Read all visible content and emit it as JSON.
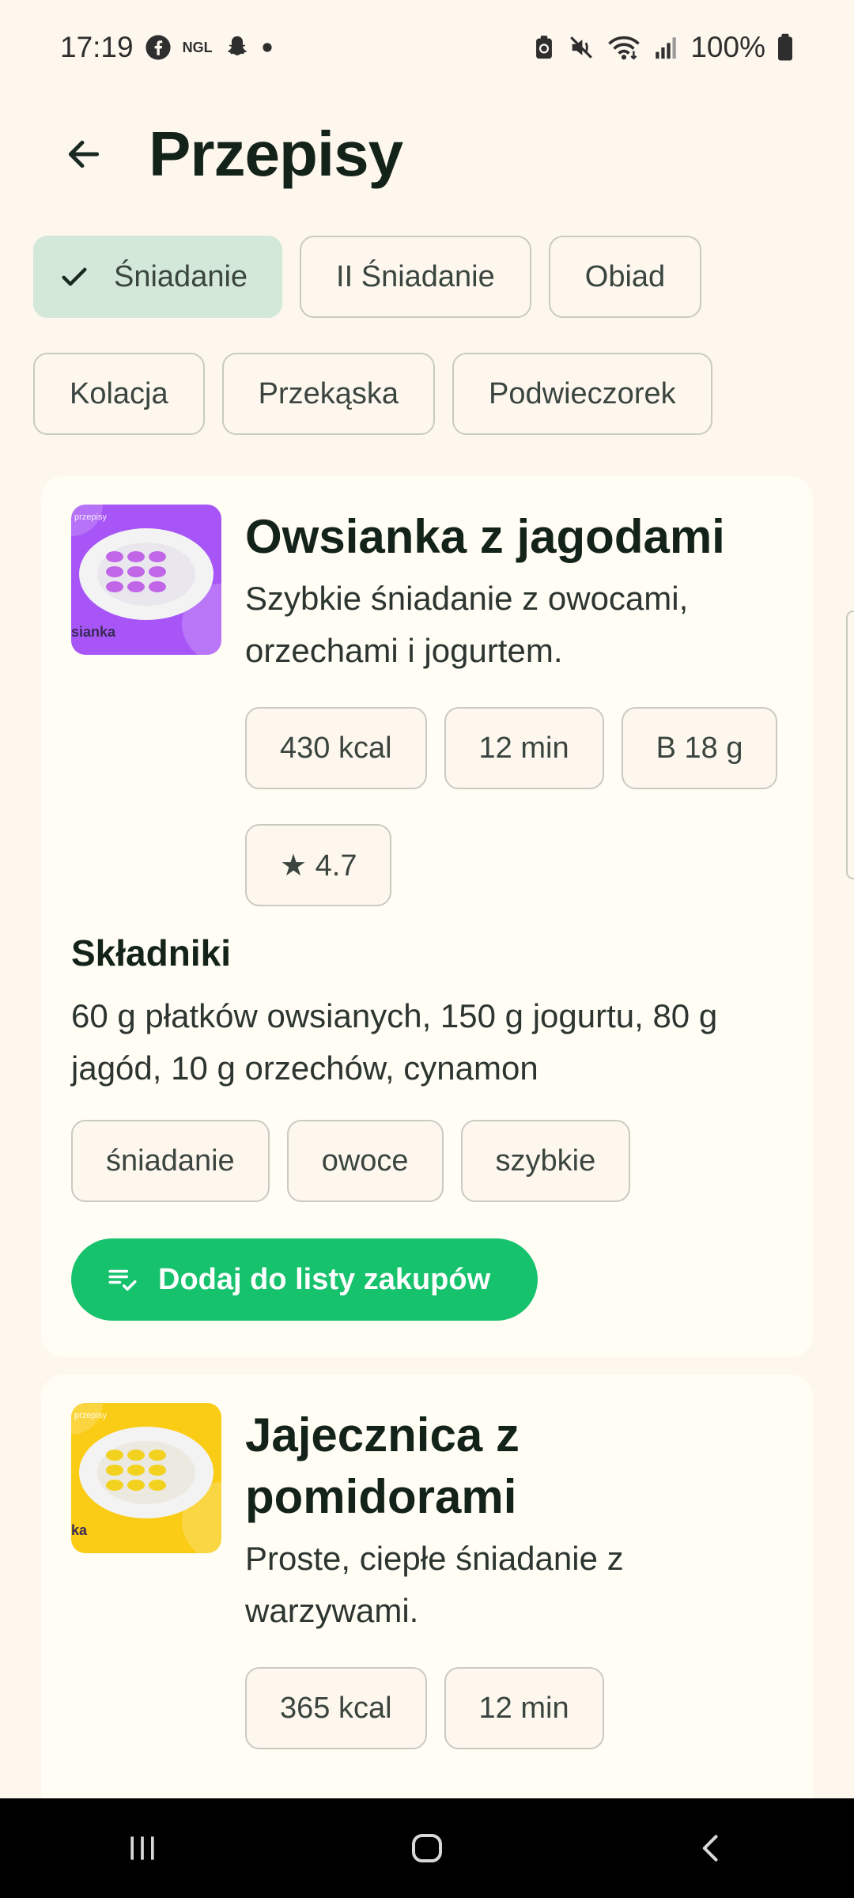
{
  "status_bar": {
    "time": "17:19",
    "notif_icons": [
      "facebook-icon",
      "ngl-icon",
      "snapchat-icon",
      "dot-icon"
    ],
    "ngl_text": "NGL",
    "system_icons": [
      "battery-saver-icon",
      "mute-icon",
      "wifi-icon",
      "signal-icon"
    ],
    "battery": "100%"
  },
  "header": {
    "title": "Przepisy",
    "back_icon": "arrow-left-icon"
  },
  "filters": [
    {
      "label": "Śniadanie",
      "selected": true
    },
    {
      "label": "II Śniadanie",
      "selected": false
    },
    {
      "label": "Obiad",
      "selected": false
    },
    {
      "label": "Kolacja",
      "selected": false
    },
    {
      "label": "Przekąska",
      "selected": false
    },
    {
      "label": "Podwieczorek",
      "selected": false
    }
  ],
  "recipes": [
    {
      "thumb_color": "#a855f7",
      "thumb_top_text": "przepisy",
      "thumb_bottom_text": "sianka",
      "title": "Owsianka z jagodami",
      "description": "Szybkie śniadanie z owocami, orzechami i jogurtem.",
      "kcal": "430 kcal",
      "time": "12 min",
      "protein": "B 18 g",
      "rating": "★ 4.7",
      "ingredients_heading": "Składniki",
      "ingredients": "60 g płatków owsianych, 150 g jogurtu, 80 g jagód, 10 g orzechów, cynamon",
      "tags": [
        "śniadanie",
        "owoce",
        "szybkie"
      ],
      "cta_label": "Dodaj do listy zakupów",
      "cta_icon": "playlist-add-check-icon"
    },
    {
      "thumb_color": "#facc15",
      "thumb_top_text": "przepisy",
      "thumb_bottom_text": "ka",
      "title": "Jajecznica z pomidorami",
      "description": "Proste, ciepłe śniadanie z warzywami.",
      "kcal": "365 kcal",
      "time": "12 min"
    }
  ],
  "colors": {
    "background": "#fdf7ee",
    "selected_chip": "#d3e8d8",
    "cta": "#17c26d"
  },
  "nav_bar": {
    "icons": [
      "recent-apps-icon",
      "home-icon",
      "back-icon"
    ]
  }
}
